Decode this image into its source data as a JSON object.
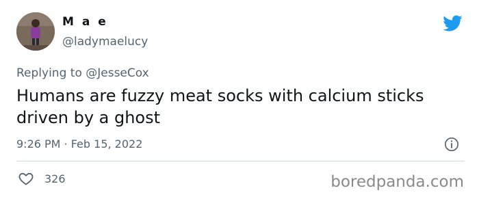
{
  "author": {
    "display_name": "M a e",
    "handle": "@ladymaelucy"
  },
  "reply": {
    "prefix": "Replying to ",
    "mention": "@JesseCox"
  },
  "tweet": {
    "text": "Humans are fuzzy meat socks with calcium sticks driven by a ghost",
    "timestamp": "9:26 PM · Feb 15, 2022"
  },
  "engagement": {
    "likes": "326"
  },
  "watermark": "boredpanda.com",
  "colors": {
    "twitter_blue": "#1d9bf0",
    "secondary_text": "#536471",
    "primary_text": "#0f1419",
    "divider": "#cfd9de"
  },
  "icons": [
    "twitter-bird-icon",
    "info-icon",
    "heart-icon"
  ]
}
